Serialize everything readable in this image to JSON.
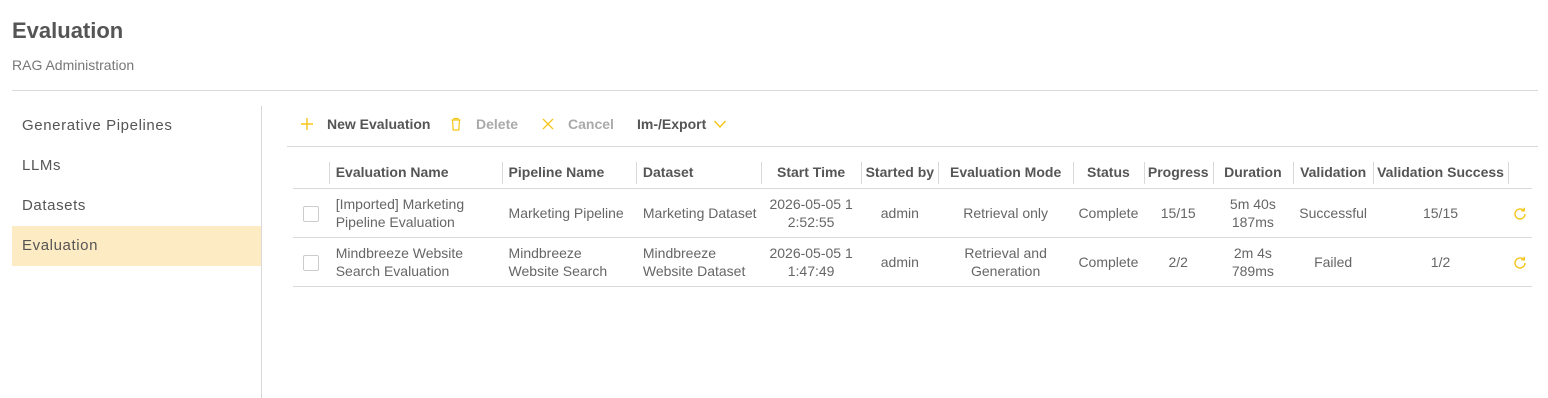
{
  "header": {
    "title": "Evaluation",
    "subtitle": "RAG Administration"
  },
  "sidebar": {
    "items": [
      {
        "label": "Generative Pipelines"
      },
      {
        "label": "LLMs"
      },
      {
        "label": "Datasets"
      },
      {
        "label": "Evaluation",
        "active": true
      }
    ]
  },
  "toolbar": {
    "new_label": "New Evaluation",
    "delete_label": "Delete",
    "cancel_label": "Cancel",
    "export_label": "Im-/Export"
  },
  "table": {
    "columns": [
      "Evaluation Name",
      "Pipeline Name",
      "Dataset",
      "Start Time",
      "Started by",
      "Evaluation Mode",
      "Status",
      "Progress",
      "Duration",
      "Validation",
      "Validation Success"
    ],
    "rows": [
      {
        "name_l1": "[Imported] Marketing",
        "name_l2": "Pipeline Evaluation",
        "pipeline_l1": "Marketing Pipeline",
        "pipeline_l2": "",
        "dataset_l1": "Marketing Dataset",
        "dataset_l2": "",
        "start_l1": "2026-05-05 1",
        "start_l2": "2:52:55",
        "started_by": "admin",
        "mode_l1": "Retrieval only",
        "mode_l2": "",
        "status": "Complete",
        "progress": "15/15",
        "duration_l1": "5m 40s",
        "duration_l2": "187ms",
        "validation": "Successful",
        "validation_success": "15/15"
      },
      {
        "name_l1": "Mindbreeze Website",
        "name_l2": "Search Evaluation",
        "pipeline_l1": "Mindbreeze",
        "pipeline_l2": "Website Search",
        "dataset_l1": "Mindbreeze",
        "dataset_l2": "Website Dataset",
        "start_l1": "2026-05-05 1",
        "start_l2": "1:47:49",
        "started_by": "admin",
        "mode_l1": "Retrieval and",
        "mode_l2": "Generation",
        "status": "Complete",
        "progress": "2/2",
        "duration_l1": "2m 4s",
        "duration_l2": "789ms",
        "validation": "Failed",
        "validation_success": "1/2"
      }
    ]
  },
  "icons": {
    "accent_color": "#f5c518",
    "add": "plus-icon",
    "delete": "trash-icon",
    "cancel": "x-icon",
    "export": "chevron-down-icon",
    "refresh": "refresh-icon"
  }
}
